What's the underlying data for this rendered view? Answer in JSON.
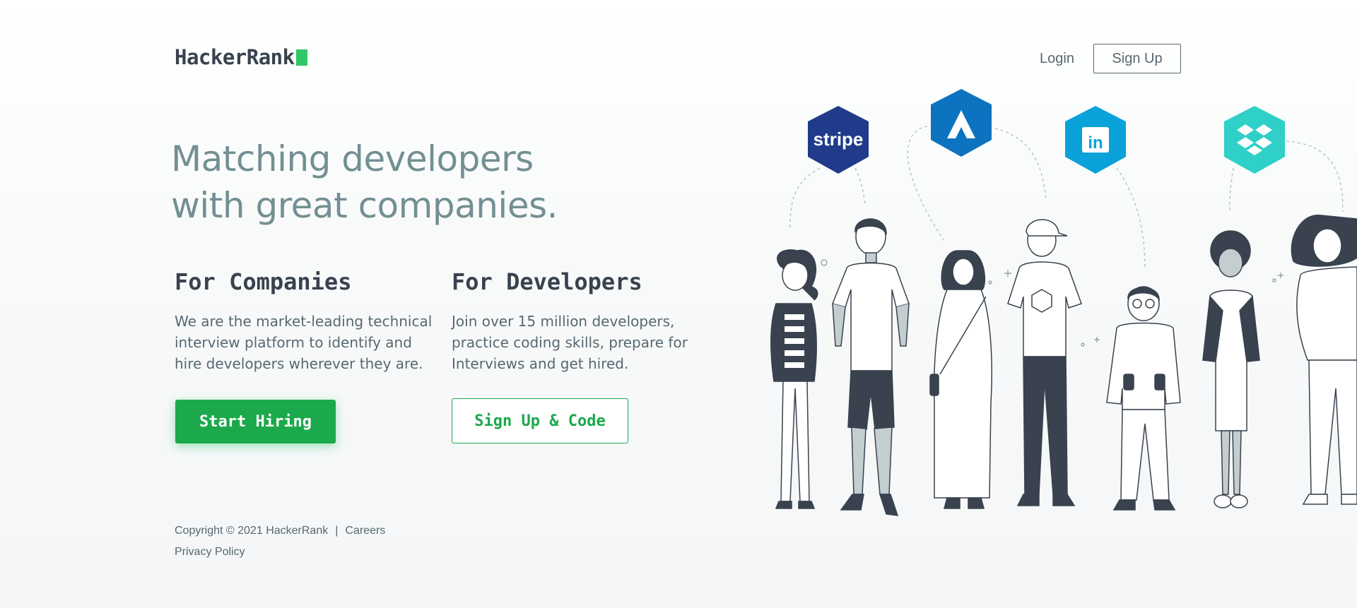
{
  "header": {
    "logo_text": "HackerRank",
    "login_label": "Login",
    "signup_label": "Sign Up"
  },
  "hero": {
    "title_line1": "Matching developers",
    "title_line2": "with great companies."
  },
  "companies": {
    "heading": "For Companies",
    "text": "We are the market-leading technical interview platform to identify and hire developers wherever they are.",
    "button_label": "Start Hiring"
  },
  "developers": {
    "heading": "For Developers",
    "text": "Join over 15 million developers, practice coding skills, prepare for Interviews and get hired.",
    "button_label": "Sign Up & Code"
  },
  "footer": {
    "copyright": "Copyright © 2021 HackerRank",
    "separator": "|",
    "careers_label": "Careers",
    "privacy_label": "Privacy Policy"
  },
  "illustration": {
    "logos": [
      {
        "name": "stripe",
        "label": "stripe",
        "color": "#1f3b8a"
      },
      {
        "name": "atlassian",
        "label": "",
        "color": "#0c73c0"
      },
      {
        "name": "linkedin",
        "label": "in",
        "color": "#0aa2d8"
      },
      {
        "name": "dropbox",
        "label": "",
        "color": "#2fd0c7"
      }
    ]
  },
  "colors": {
    "brand_green": "#1ba94c",
    "logo_green": "#2ec866",
    "text_dark": "#39424e",
    "text_muted": "#576871",
    "title_color": "#738f93"
  }
}
